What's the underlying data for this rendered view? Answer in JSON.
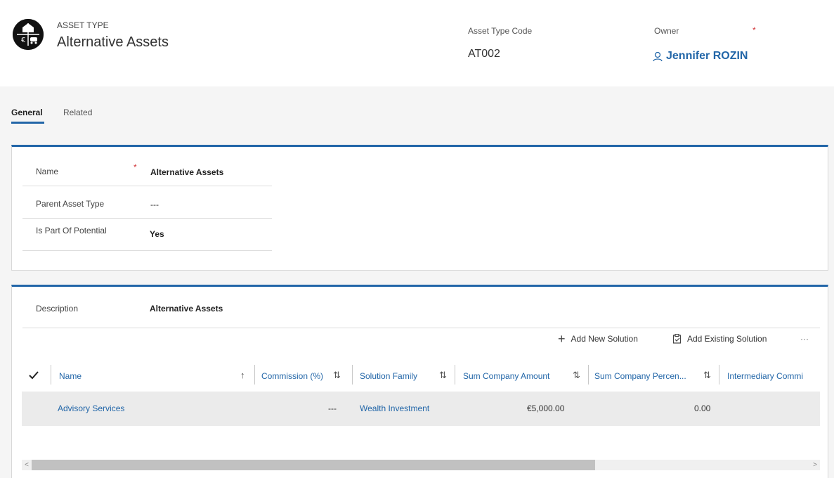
{
  "header": {
    "entity_type": "ASSET TYPE",
    "title": "Alternative Assets",
    "icon": "asset-type-icon",
    "asset_code_label": "Asset Type Code",
    "asset_code_value": "AT002",
    "owner_label": "Owner",
    "owner_required": "*",
    "owner_value": "Jennifer ROZIN",
    "owner_icon": "person-icon"
  },
  "tabs": [
    {
      "label": "General",
      "active": true
    },
    {
      "label": "Related",
      "active": false
    }
  ],
  "general": {
    "name_label": "Name",
    "name_required": "*",
    "name_value": "Alternative Assets",
    "parent_label": "Parent Asset Type",
    "parent_value": "---",
    "potential_label": "Is Part Of Potential",
    "potential_value": "Yes"
  },
  "details": {
    "description_label": "Description",
    "description_value": "Alternative Assets"
  },
  "commands": {
    "add_new": "Add New Solution",
    "add_existing": "Add Existing Solution",
    "more": "···"
  },
  "grid": {
    "columns": [
      "Name",
      "Commission (%)",
      "Solution Family",
      "Sum Company Amount",
      "Sum Company Percen...",
      "Intermediary Commi"
    ],
    "rows": [
      {
        "name": "Advisory Services",
        "commission": "---",
        "family": "Wealth Investment",
        "sum_amount": "€5,000.00",
        "sum_percent": "0.00"
      }
    ]
  },
  "colors": {
    "accent": "#2266a8",
    "required": "#d13438"
  }
}
